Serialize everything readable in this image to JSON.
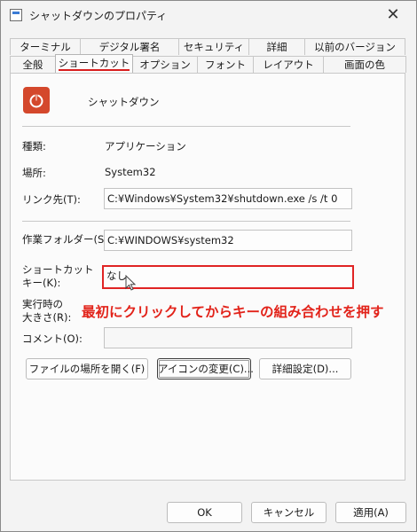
{
  "window": {
    "title": "シャットダウンのプロパティ",
    "close_glyph": "✕"
  },
  "tabs": {
    "row1": [
      "ターミナル",
      "デジタル署名",
      "セキュリティ",
      "詳細",
      "以前のバージョン"
    ],
    "row2": [
      "全般",
      "ショートカット",
      "オプション",
      "フォント",
      "レイアウト",
      "画面の色"
    ],
    "active": "ショートカット"
  },
  "shortcut": {
    "name": "シャットダウン",
    "type_label": "種類:",
    "type_value": "アプリケーション",
    "location_label": "場所:",
    "location_value": "System32",
    "target_label": "リンク先(T):",
    "target_value": "C:¥Windows¥System32¥shutdown.exe /s /t 0",
    "startin_label": "作業フォルダー(S):",
    "startin_value": "C:¥WINDOWS¥system32",
    "hotkey_label_1": "ショートカット",
    "hotkey_label_2": "キー(K):",
    "hotkey_value": "なし",
    "run_label_1": "実行時の",
    "run_label_2": "大きさ(R):",
    "comment_label": "コメント(O):",
    "comment_value": "",
    "annotation": "最初にクリックしてからキーの組み合わせを押す"
  },
  "buttons": {
    "open_location": "ファイルの場所を開く(F)",
    "change_icon": "アイコンの変更(C)...",
    "advanced": "詳細設定(D)...",
    "ok": "OK",
    "cancel": "キャンセル",
    "apply": "適用(A)"
  },
  "colors": {
    "icon_bg": "#d4482c",
    "highlight": "#e02424",
    "annotation": "#e2231a"
  }
}
